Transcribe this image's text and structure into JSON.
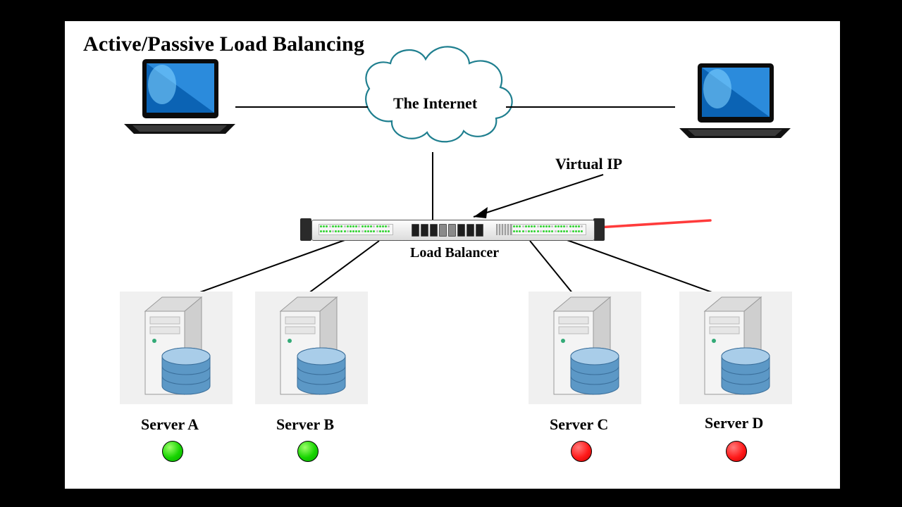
{
  "title": "Active/Passive Load Balancing",
  "cloud_label": "The Internet",
  "virtual_ip_label": "Virtual IP",
  "load_balancer_label": "Load Balancer",
  "servers": [
    {
      "name": "Server A",
      "status": "active",
      "status_color": "#17d400"
    },
    {
      "name": "Server B",
      "status": "active",
      "status_color": "#17d400"
    },
    {
      "name": "Server C",
      "status": "passive",
      "status_color": "#ff1a1a"
    },
    {
      "name": "Server D",
      "status": "passive",
      "status_color": "#ff1a1a"
    }
  ],
  "clients": [
    {
      "side": "left"
    },
    {
      "side": "right"
    }
  ]
}
